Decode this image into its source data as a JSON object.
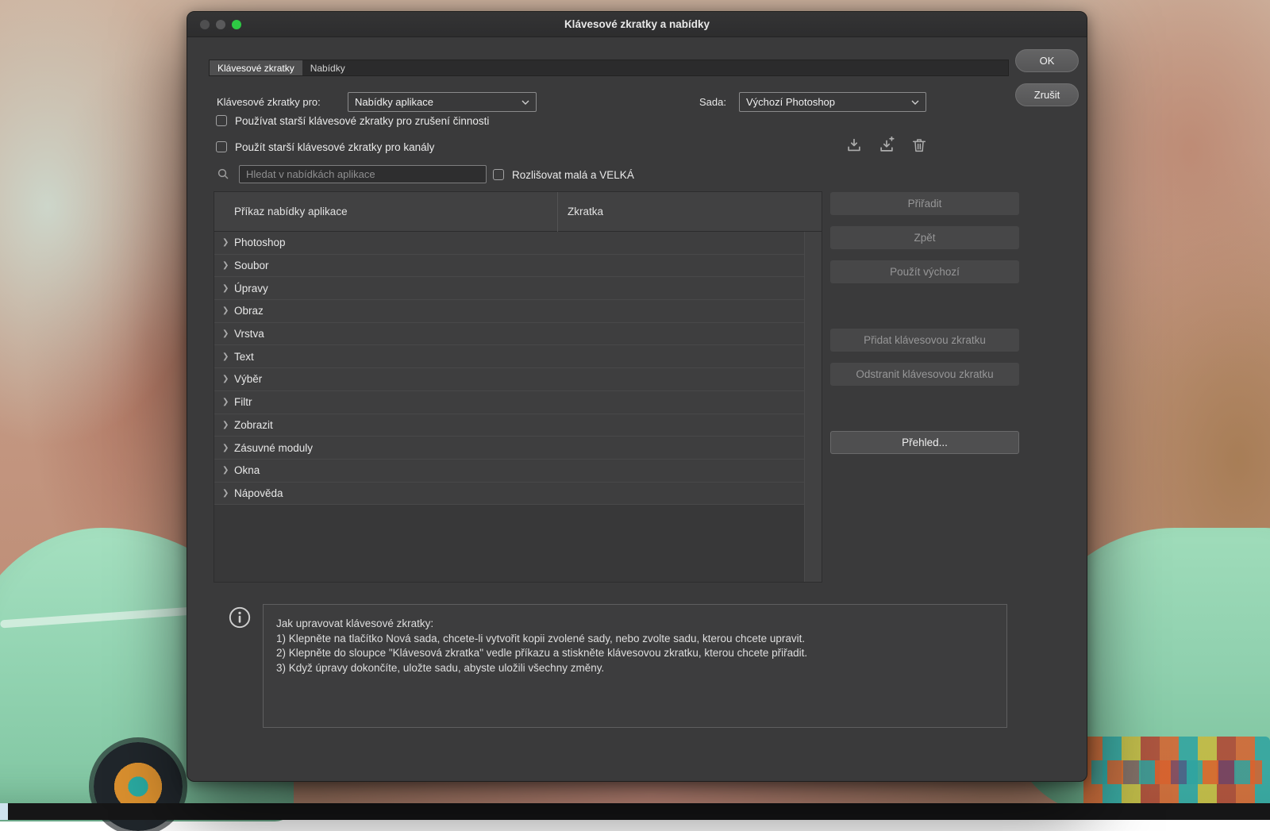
{
  "window": {
    "title": "Klávesové zkratky a nabídky",
    "ok": "OK",
    "cancel": "Zrušit",
    "tabs": [
      {
        "label": "Klávesové zkratky",
        "active": true
      },
      {
        "label": "Nabídky",
        "active": false
      }
    ],
    "traffic_green": "#2ec944"
  },
  "controls": {
    "shortcuts_for_label": "Klávesové zkratky pro:",
    "shortcuts_for_value": "Nabídky aplikace",
    "set_label": "Sada:",
    "set_value": "Výchozí Photoshop",
    "legacy_undo_checkbox": "Používat starší klávesové zkratky pro zrušení činnosti",
    "legacy_channels_checkbox": "Použít starší klávesové zkratky pro kanály",
    "search_placeholder": "Hledat v nabídkách aplikace",
    "case_checkbox": "Rozlišovat malá a VELKÁ"
  },
  "table": {
    "columns": [
      "Příkaz nabídky aplikace",
      "Zkratka"
    ],
    "rows": [
      "Photoshop",
      "Soubor",
      "Úpravy",
      "Obraz",
      "Vrstva",
      "Text",
      "Výběr",
      "Filtr",
      "Zobrazit",
      "Zásuvné moduly",
      "Okna",
      "Nápověda"
    ]
  },
  "actions": {
    "assign": "Přiřadit",
    "undo": "Zpět",
    "use_default": "Použít výchozí",
    "add_shortcut": "Přidat klávesovou zkratku",
    "delete_shortcut": "Odstranit klávesovou zkratku",
    "summary": "Přehled..."
  },
  "info": {
    "lines": [
      "Jak upravovat klávesové zkratky:",
      "1) Klepněte na tlačítko Nová sada, chcete-li vytvořit kopii zvolené sady, nebo zvolte sadu, kterou chcete upravit.",
      "2) Klepněte do sloupce \"Klávesová zkratka\" vedle příkazu a stiskněte klávesovou zkratku, kterou chcete přiřadit.",
      "3) Když úpravy dokončíte, uložte sadu, abyste uložili všechny změny."
    ]
  }
}
